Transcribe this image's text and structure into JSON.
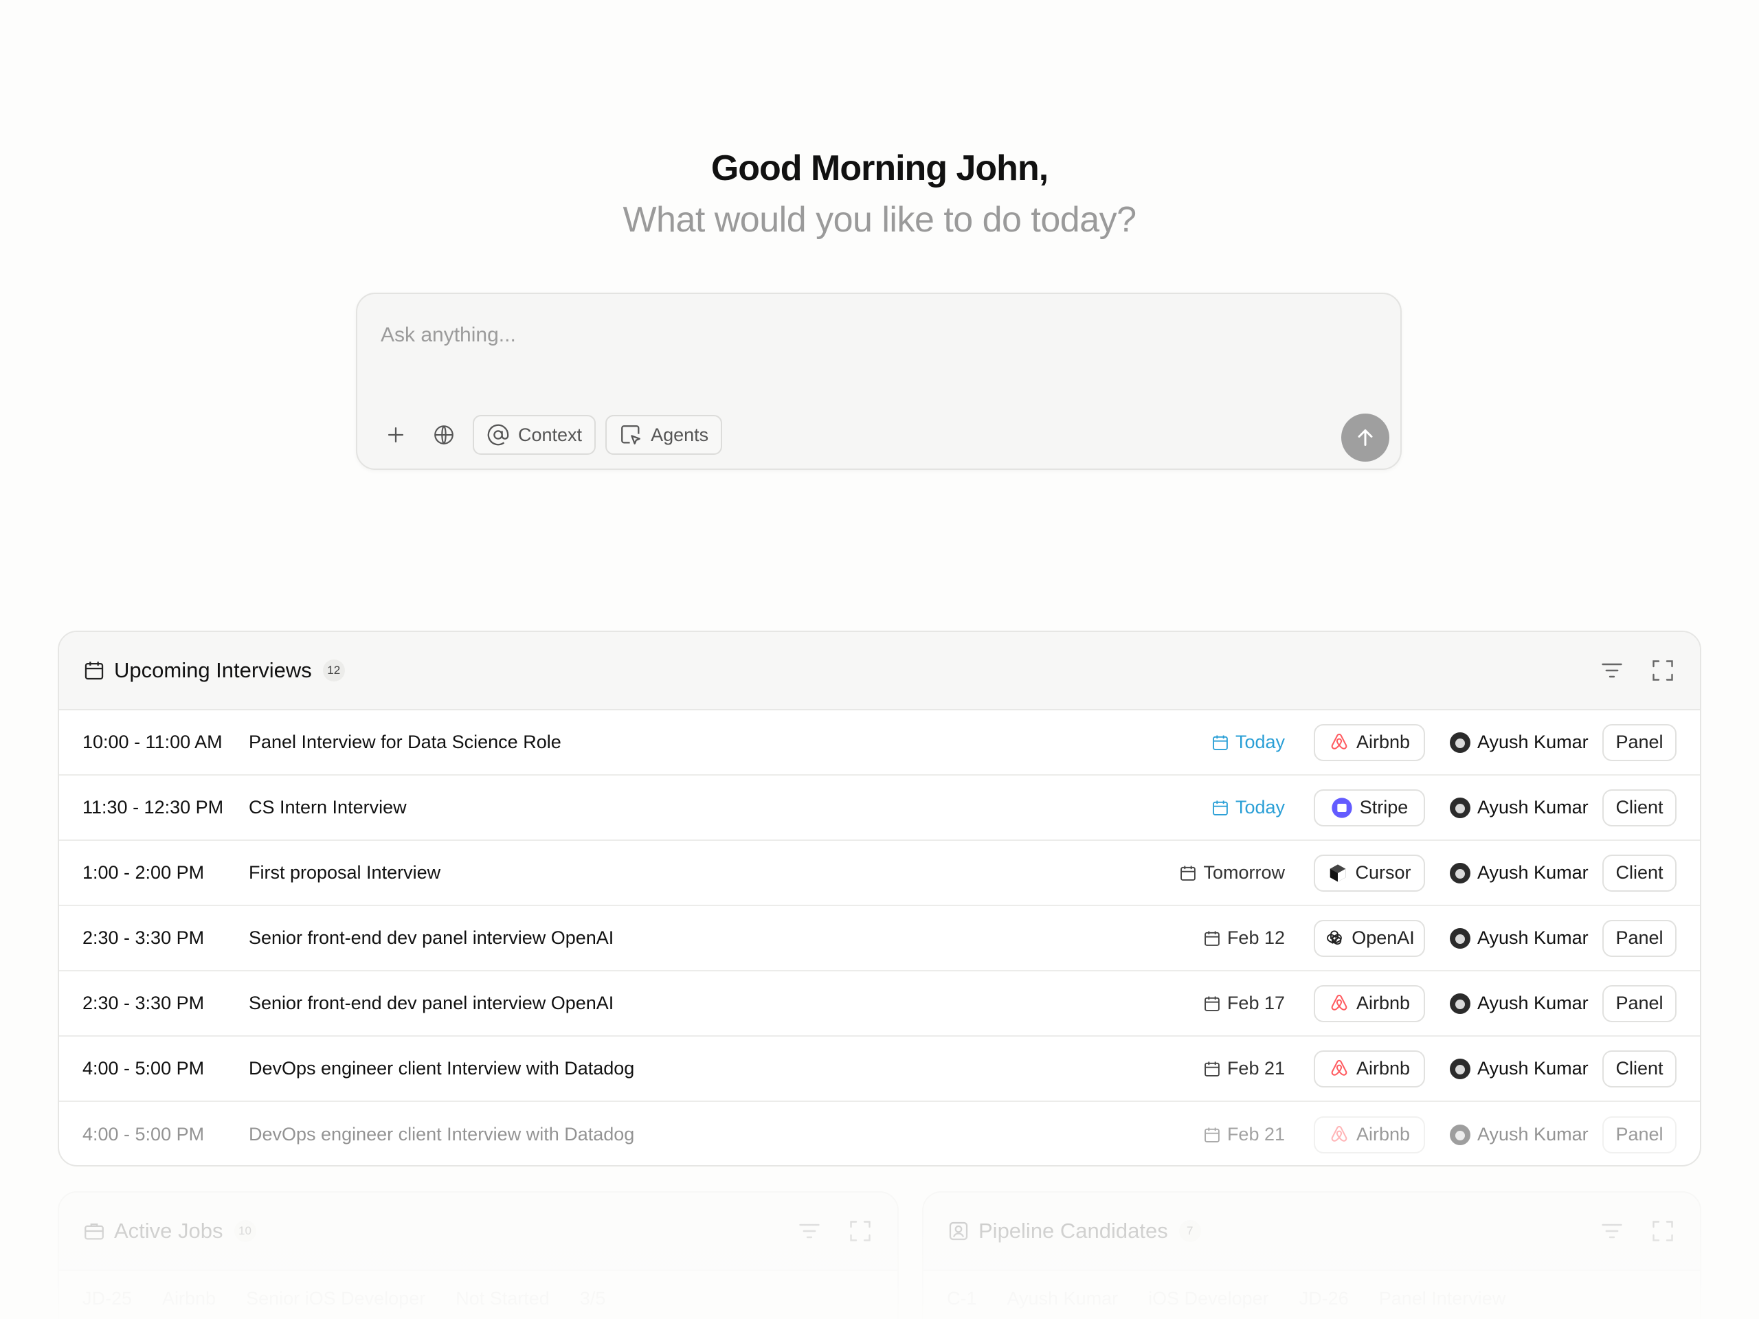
{
  "hero": {
    "greeting": "Good Morning John,",
    "subtitle": "What would you like to do today?"
  },
  "ask": {
    "placeholder": "Ask anything...",
    "tools": {
      "add_icon": "plus-icon",
      "web_icon": "globe-icon",
      "context_label": "Context",
      "agents_label": "Agents"
    },
    "send_icon": "arrow-up-icon"
  },
  "interviews": {
    "title": "Upcoming Interviews",
    "count": "12",
    "rows": [
      {
        "time": "10:00 - 11:00 AM",
        "title": "Panel Interview for Data Science Role",
        "date": "Today",
        "today": true,
        "company": "Airbnb",
        "company_icon": "airbnb-logo",
        "person": "Ayush Kumar",
        "type": "Panel"
      },
      {
        "time": "11:30 - 12:30 PM",
        "title": "CS Intern Interview",
        "date": "Today",
        "today": true,
        "company": "Stripe",
        "company_icon": "stripe-logo",
        "person": "Ayush Kumar",
        "type": "Client"
      },
      {
        "time": "1:00 - 2:00 PM",
        "title": "First proposal Interview",
        "date": "Tomorrow",
        "today": false,
        "company": "Cursor",
        "company_icon": "cursor-logo",
        "person": "Ayush Kumar",
        "type": "Client"
      },
      {
        "time": "2:30 - 3:30 PM",
        "title": "Senior front-end dev panel interview OpenAI",
        "date": "Feb 12",
        "today": false,
        "company": "OpenAI",
        "company_icon": "openai-logo",
        "person": "Ayush Kumar",
        "type": "Panel"
      },
      {
        "time": "2:30 - 3:30 PM",
        "title": "Senior front-end dev panel interview OpenAI",
        "date": "Feb 17",
        "today": false,
        "company": "Airbnb",
        "company_icon": "airbnb-logo",
        "person": "Ayush Kumar",
        "type": "Panel"
      },
      {
        "time": "4:00 - 5:00 PM",
        "title": "DevOps engineer client Interview with Datadog",
        "date": "Feb 21",
        "today": false,
        "company": "Airbnb",
        "company_icon": "airbnb-logo",
        "person": "Ayush Kumar",
        "type": "Client"
      },
      {
        "time": "4:00 - 5:00 PM",
        "title": "DevOps engineer client Interview with Datadog",
        "date": "Feb 21",
        "today": false,
        "company": "Airbnb",
        "company_icon": "airbnb-logo",
        "person": "Ayush Kumar",
        "type": "Panel"
      }
    ]
  },
  "active_jobs": {
    "title": "Active Jobs",
    "count": "10",
    "row": {
      "id": "JD-25",
      "company": "Airbnb",
      "role": "Senior iOS Developer",
      "status": "Not Started",
      "progress": "3/5"
    }
  },
  "pipeline": {
    "title": "Pipeline Candidates",
    "count": "7",
    "row": {
      "id": "C-1",
      "person": "Ayush Kumar",
      "role": "iOS Developer",
      "job": "JD-26",
      "stage": "Panel Interview"
    }
  },
  "colors": {
    "accent_today": "#2a9fd6",
    "airbnb": "#ff5a5f",
    "stripe": "#635bff"
  }
}
